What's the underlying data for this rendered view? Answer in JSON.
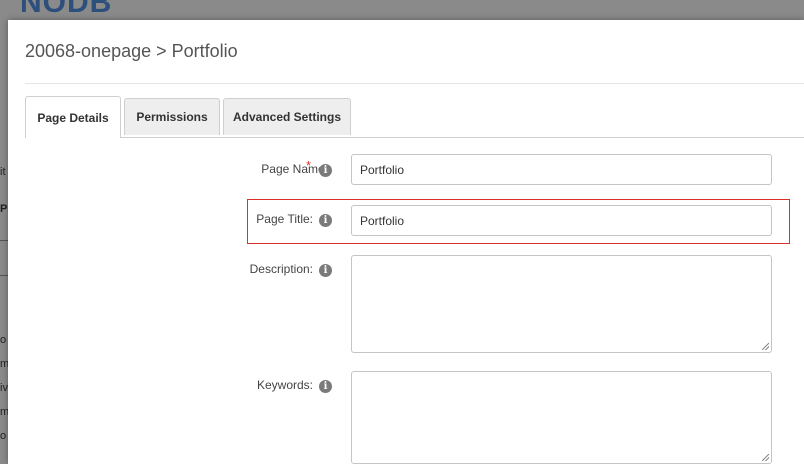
{
  "background": {
    "logo_text": "NODB",
    "fragments": [
      "it",
      "P",
      "o",
      "m",
      "iv",
      "m",
      "o"
    ]
  },
  "modal": {
    "title": "20068-onepage > Portfolio"
  },
  "tabs": [
    {
      "label": "Page Details",
      "active": true
    },
    {
      "label": "Permissions",
      "active": false
    },
    {
      "label": "Advanced Settings",
      "active": false
    }
  ],
  "form": {
    "page_name": {
      "label": "Page Name:",
      "required_mark": "*",
      "value": "Portfolio"
    },
    "page_title": {
      "label": "Page Title:",
      "value": "Portfolio"
    },
    "description": {
      "label": "Description:",
      "value": ""
    },
    "keywords": {
      "label": "Keywords:",
      "value": ""
    }
  },
  "colors": {
    "required": "#d9302b",
    "highlight_border": "#d9302b",
    "logo": "#2c4f7c"
  },
  "icons": [
    "info-icon"
  ]
}
